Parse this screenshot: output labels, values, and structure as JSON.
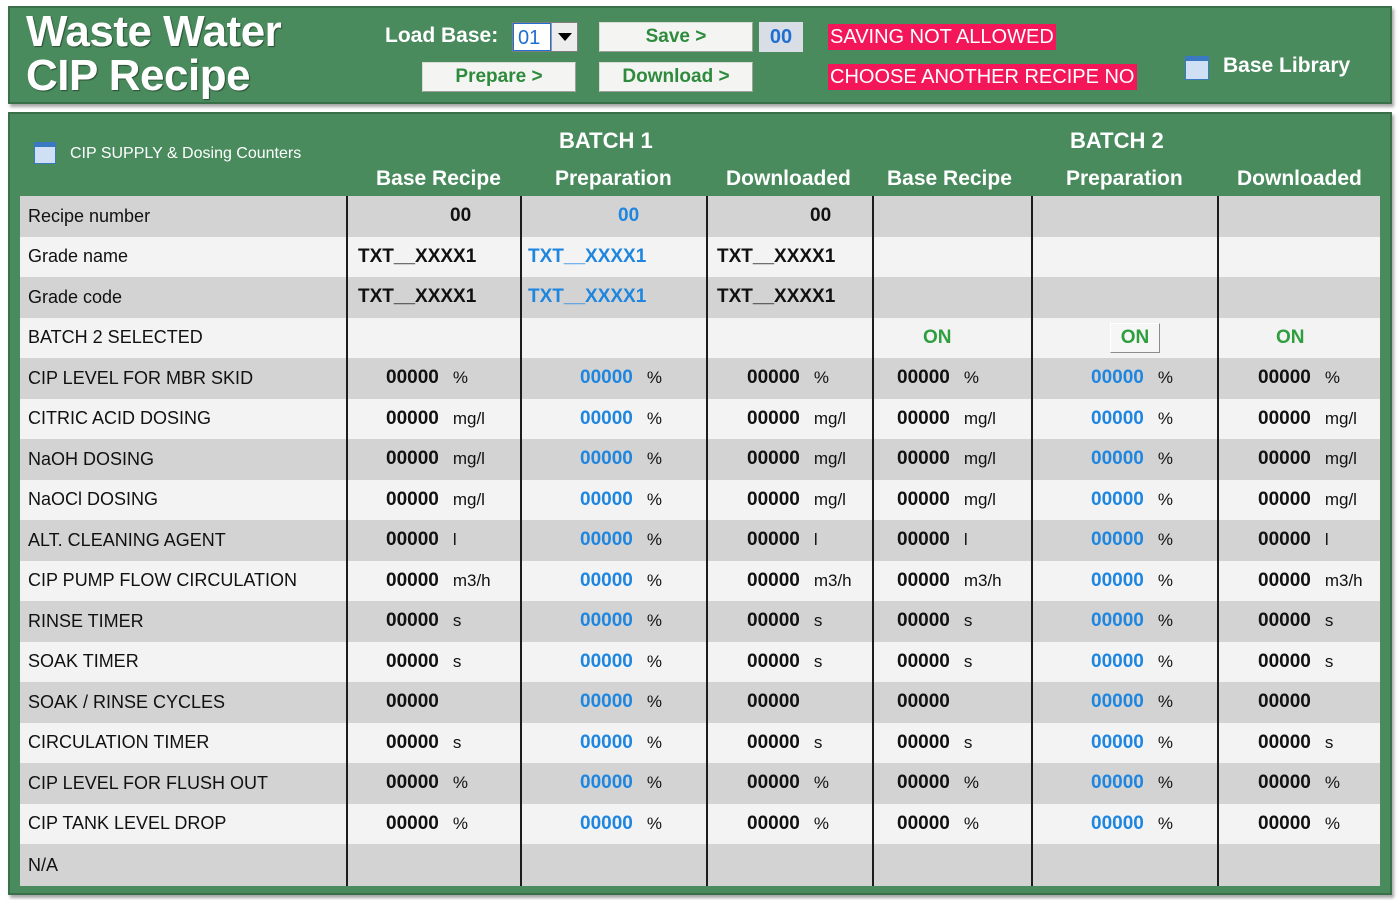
{
  "header": {
    "title_line1": "Waste Water",
    "title_line2": "CIP Recipe",
    "load_base_label": "Load Base:",
    "load_base_value": "01",
    "save_label": "Save >",
    "save_number": "00",
    "prepare_label": "Prepare >",
    "download_label": "Download >",
    "alert_saving": "SAVING NOT ALLOWED",
    "alert_choose": "CHOOSE ANOTHER RECIPE NO",
    "base_library_label": "Base Library"
  },
  "panel": {
    "section_title": "CIP SUPPLY & Dosing Counters",
    "batch1_title": "BATCH 1",
    "batch2_title": "BATCH 2",
    "col_base_recipe": "Base Recipe",
    "col_preparation": "Preparation",
    "col_downloaded": "Downloaded"
  },
  "rows": {
    "recipe_number": {
      "label": "Recipe number",
      "b1_base": "00",
      "b1_prep": "00",
      "b1_down": "00"
    },
    "grade_name": {
      "label": "Grade name",
      "b1_base": "TXT__XXXX1",
      "b1_prep": "TXT__XXXX1",
      "b1_down": "TXT__XXXX1"
    },
    "grade_code": {
      "label": "Grade code",
      "b1_base": "TXT__XXXX1",
      "b1_prep": "TXT__XXXX1",
      "b1_down": "TXT__XXXX1"
    },
    "batch2_selected": {
      "label": "BATCH 2 SELECTED",
      "b2_base": "ON",
      "b2_prep": "ON",
      "b2_down": "ON"
    },
    "params": [
      {
        "label": "CIP LEVEL FOR MBR SKID",
        "value": "00000",
        "prep": "00000",
        "unit": "%",
        "prep_unit": "%"
      },
      {
        "label": "CITRIC ACID DOSING",
        "value": "00000",
        "prep": "00000",
        "unit": "mg/l",
        "prep_unit": "%"
      },
      {
        "label": "NaOH DOSING",
        "value": "00000",
        "prep": "00000",
        "unit": "mg/l",
        "prep_unit": "%"
      },
      {
        "label": "NaOCl DOSING",
        "value": "00000",
        "prep": "00000",
        "unit": "mg/l",
        "prep_unit": "%"
      },
      {
        "label": "ALT. CLEANING AGENT",
        "value": "00000",
        "prep": "00000",
        "unit": "l",
        "prep_unit": "%"
      },
      {
        "label": "CIP PUMP FLOW CIRCULATION",
        "value": "00000",
        "prep": "00000",
        "unit": "m3/h",
        "prep_unit": "%"
      },
      {
        "label": "RINSE TIMER",
        "value": "00000",
        "prep": "00000",
        "unit": "s",
        "prep_unit": "%"
      },
      {
        "label": "SOAK TIMER",
        "value": "00000",
        "prep": "00000",
        "unit": "s",
        "prep_unit": "%"
      },
      {
        "label": "SOAK / RINSE CYCLES",
        "value": "00000",
        "prep": "00000",
        "unit": "",
        "prep_unit": "%"
      },
      {
        "label": "CIRCULATION TIMER",
        "value": "00000",
        "prep": "00000",
        "unit": "s",
        "prep_unit": "%"
      },
      {
        "label": "CIP LEVEL FOR FLUSH OUT",
        "value": "00000",
        "prep": "00000",
        "unit": "%",
        "prep_unit": "%"
      },
      {
        "label": "CIP TANK LEVEL DROP",
        "value": "00000",
        "prep": "00000",
        "unit": "%",
        "prep_unit": "%"
      }
    ],
    "na": {
      "label": "N/A"
    }
  },
  "colors": {
    "panel_green": "#4a8b5e",
    "value_blue": "#1f86e0",
    "on_green": "#2e9e3e",
    "alert_red": "#f3175a"
  }
}
